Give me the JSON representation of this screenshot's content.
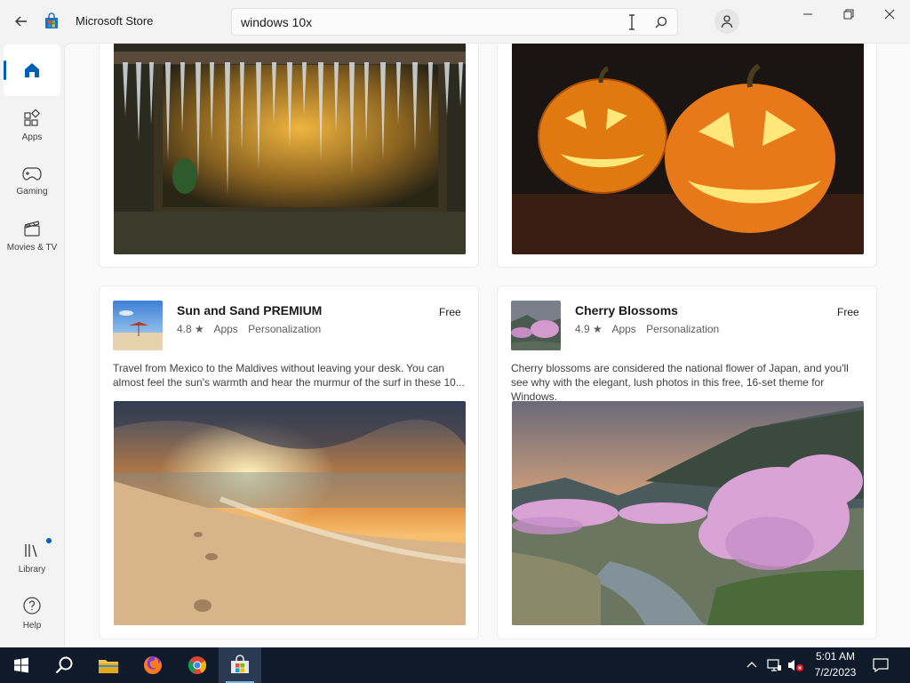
{
  "window": {
    "app_title": "Microsoft Store",
    "search_value": "windows 10x",
    "controls": [
      "minimize",
      "maximize",
      "close"
    ]
  },
  "sidebar": {
    "items": [
      {
        "label": "",
        "icon": "home-icon",
        "active": true
      },
      {
        "label": "Apps",
        "icon": "apps-icon"
      },
      {
        "label": "Gaming",
        "icon": "gamepad-icon"
      },
      {
        "label": "Movies & TV",
        "icon": "movies-icon"
      },
      {
        "label": "Library",
        "icon": "library-icon",
        "badge": true
      },
      {
        "label": "Help",
        "icon": "help-icon"
      }
    ]
  },
  "cards": [
    {
      "preview": "icicles-window-image"
    },
    {
      "preview": "jack-o-lanterns-image"
    },
    {
      "title": "Sun and Sand PREMIUM",
      "rating": "4.8 ★",
      "category": "Apps",
      "subcategory": "Personalization",
      "price": "Free",
      "description": "Travel from Mexico to the Maldives without leaving your desk. You can almost feel the sun's warmth and hear the murmur of the surf in these 10...",
      "preview": "beach-sunset-image"
    },
    {
      "title": "Cherry Blossoms",
      "rating": "4.9 ★",
      "category": "Apps",
      "subcategory": "Personalization",
      "price": "Free",
      "description": "Cherry blossoms are considered the national flower of Japan, and you'll see why with the elegant, lush photos in this free, 16-set theme for Windows.",
      "preview": "cherry-blossom-valley-image"
    }
  ],
  "taskbar": {
    "apps": [
      "start-icon",
      "search-icon",
      "file-explorer-icon",
      "firefox-icon",
      "chrome-icon",
      "microsoft-store-icon"
    ],
    "time": "5:01 AM",
    "date": "7/2/2023"
  },
  "colors": {
    "accent": "#005fb8",
    "taskbar": "#0f1a2b"
  }
}
